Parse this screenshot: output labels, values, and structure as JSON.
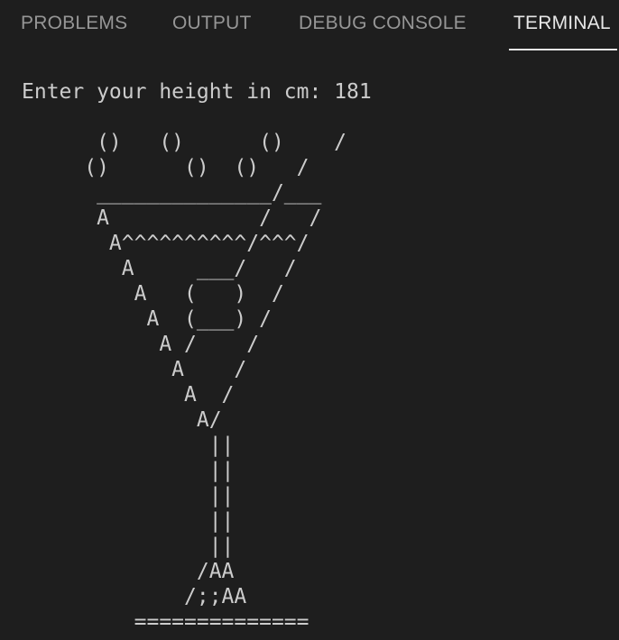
{
  "tabs": {
    "problems": "PROBLEMS",
    "output": "OUTPUT",
    "debug_console": "DEBUG CONSOLE",
    "terminal": "TERMINAL",
    "active": "terminal"
  },
  "terminal": {
    "prompt": "Enter your height in cm: ",
    "input": "181",
    "art": "      ()   ()      ()    /\n     ()      ()  ()   /\n      ______________/___\n      A            /   /\n       A^^^^^^^^^^/^^^/\n        A     ___/   /\n         A   (   )  /\n          A  (___) /\n           A /    /\n            A    /\n             A  /\n              A/\n               ||\n               ||\n               ||\n               ||\n               ||\n              /AA\n             /;;AA\n         =============="
  },
  "colors": {
    "background": "#1e1e1e",
    "tab_inactive": "#969696",
    "tab_active": "#e7e7e7",
    "terminal_text": "#cccccc"
  }
}
